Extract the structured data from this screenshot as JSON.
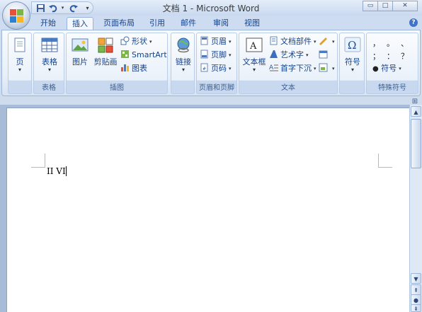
{
  "window": {
    "title": "文档 1 - Microsoft Word"
  },
  "qat": {
    "save_icon": "save-icon",
    "undo_icon": "undo-icon",
    "redo_icon": "redo-icon",
    "customize_icon": "customize-arrow-icon"
  },
  "window_controls": {
    "minimize": "▭",
    "maximize": "□",
    "close": "✕"
  },
  "tabs": [
    {
      "label": "开始"
    },
    {
      "label": "插入"
    },
    {
      "label": "页面布局"
    },
    {
      "label": "引用"
    },
    {
      "label": "邮件"
    },
    {
      "label": "审阅"
    },
    {
      "label": "视图"
    }
  ],
  "help_label": "?",
  "ribbon": {
    "pages": {
      "label": "页",
      "group": ""
    },
    "tables": {
      "label": "表格",
      "group": "表格"
    },
    "illustrations": {
      "group": "插图",
      "picture": "图片",
      "clipart": "剪贴画",
      "shapes": "形状",
      "smartart": "SmartArt",
      "chart": "图表"
    },
    "links": {
      "label": "链接",
      "group": ""
    },
    "header_footer": {
      "group": "页眉和页脚",
      "header": "页眉",
      "footer": "页脚",
      "page_number": "页码"
    },
    "text": {
      "group": "文本",
      "textbox": "文本框",
      "quickparts": "文档部件",
      "wordart": "艺术字",
      "dropcap": "首字下沉"
    },
    "symbols": {
      "label": "符号",
      "group": ""
    },
    "special": {
      "group": "特殊符号",
      "chars": [
        "，",
        "。",
        "、",
        "；",
        "：",
        "？"
      ],
      "more": "符号"
    }
  },
  "document": {
    "text": "II VI"
  }
}
